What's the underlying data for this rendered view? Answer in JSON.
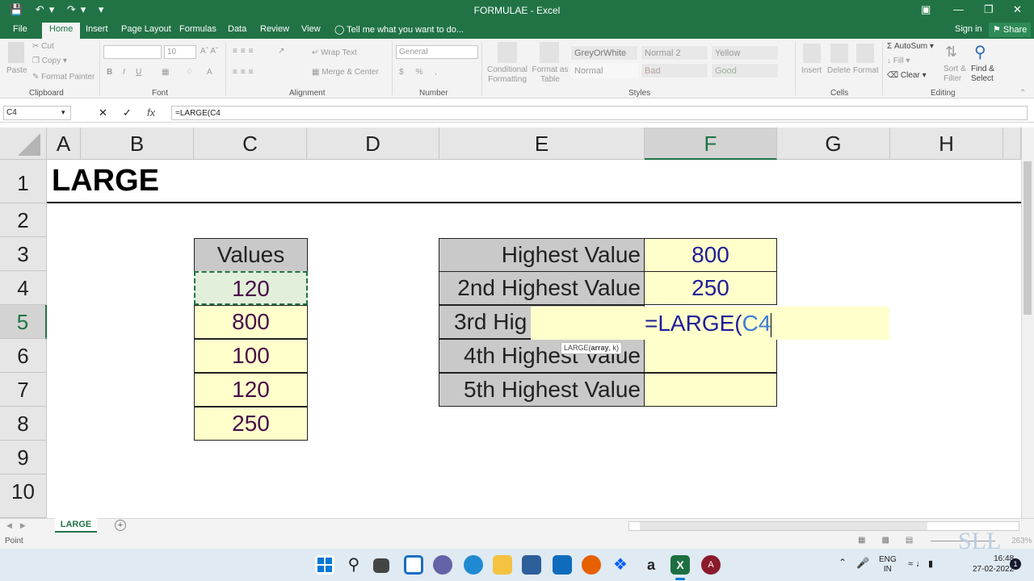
{
  "titlebar": {
    "title": "FORMULAE - Excel"
  },
  "tabs": [
    "File",
    "Home",
    "Insert",
    "Page Layout",
    "Formulas",
    "Data",
    "Review",
    "View"
  ],
  "tell_me": "Tell me what you want to do...",
  "sign_in": "Sign in",
  "share": "Share",
  "ribbon": {
    "clipboard": {
      "paste": "Paste",
      "cut": "Cut",
      "copy": "Copy",
      "format_painter": "Format Painter",
      "label": "Clipboard"
    },
    "font": {
      "size": "10",
      "label": "Font"
    },
    "alignment": {
      "wrap": "Wrap Text",
      "merge": "Merge & Center",
      "label": "Alignment"
    },
    "number": {
      "format": "General",
      "label": "Number"
    },
    "styles": {
      "conditional": "Conditional Formatting",
      "format_table": "Format as Table",
      "items": [
        "GreyOrWhite",
        "Normal 2",
        "Yellow",
        "Normal",
        "Bad",
        "Good"
      ],
      "label": "Styles"
    },
    "cells": {
      "insert": "Insert",
      "delete": "Delete",
      "format": "Format",
      "label": "Cells"
    },
    "editing": {
      "autosum": "AutoSum",
      "fill": "Fill",
      "clear": "Clear",
      "sort": "Sort & Filter",
      "find": "Find & Select",
      "label": "Editing"
    }
  },
  "formula_bar": {
    "name_box": "C4",
    "formula": "=LARGE(C4"
  },
  "columns": [
    "A",
    "B",
    "C",
    "D",
    "E",
    "F",
    "G",
    "H"
  ],
  "rows": [
    "1",
    "2",
    "3",
    "4",
    "5",
    "6",
    "7",
    "8",
    "9",
    "10"
  ],
  "sheet": {
    "title": "LARGE",
    "values_header": "Values",
    "values": [
      "120",
      "800",
      "100",
      "120",
      "250"
    ],
    "labels": [
      "Highest Value",
      "2nd Highest Value",
      "3rd Hig",
      "4th Highest Value",
      "5th Highest Value"
    ],
    "results": [
      "800",
      "250"
    ],
    "editing_formula": "=LARGE(C4",
    "formula_prefix": "=LARGE(",
    "formula_ref": "C4",
    "tooltip": {
      "fn": "LARGE(",
      "arg1": "array",
      ", k)": ", k)"
    }
  },
  "sheet_tab": "LARGE",
  "status": {
    "mode": "Point",
    "zoom": "263%"
  },
  "taskbar": {
    "lang1": "ENG",
    "lang2": "IN",
    "time": "16:48",
    "date": "27-02-2022",
    "watermark": "SLL",
    "notif": "1"
  },
  "colors": {
    "excel_green": "#217346",
    "range_highlight": "#e2efda",
    "ref_blue": "#3b7dd8"
  }
}
